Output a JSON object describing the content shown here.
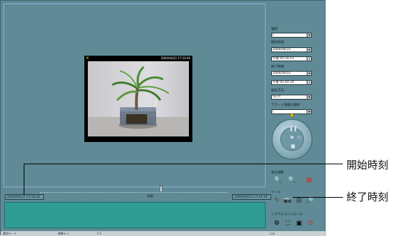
{
  "viewer": {
    "timestamp": "2004/04/22 17:23:40",
    "corner_mark": "✕"
  },
  "timeline": {
    "start": "2004/04/22 17:18:22",
    "end": "2004/04/22 17:43:16",
    "middle": "先頭"
  },
  "sidebar": {
    "field1_label": "場所:",
    "field1_value": "J",
    "start_label": "開始時間:",
    "start_date": "2004/04/22",
    "start_time": "午後 05:10:23",
    "end_label": "終了時間:",
    "end_date": "2004/04/22",
    "end_time": "午後 05:40:19",
    "playmode_label": "再生方法:",
    "playmode_value": "ﾜﾙﾚﾝｸﾞ",
    "alarm_label": "アラート領域の選択:",
    "alarm_value": "J",
    "display_label": "表示調整",
    "tools_label": "ツール",
    "system_label": "システムコントロール"
  },
  "statusbar": {
    "left": "運用モード",
    "mid1": "標準ﾌﾚｰﾄﾞ",
    "mid2": "1:1",
    "right": "ｺﾝ/ﾙ"
  },
  "callouts": {
    "start_time": "開始時刻",
    "end_time": "終了時刻"
  },
  "colors": {
    "window_bg": "#5f8a96",
    "panel_teal": "#2f9d93",
    "viewer_border": "#9aa7d8",
    "led": "#ffd600"
  },
  "icons": {
    "zoom_in": "magnifier-plus-icon",
    "zoom_out": "magnifier-minus-icon",
    "color_adjust": "color-palette-icon",
    "tool_pen": "pencil-icon",
    "tool_camera": "camera-icon",
    "tool_print": "printer-icon",
    "tool_search": "search-icon",
    "sys_settings": "settings-icon",
    "sys_network": "network-icon",
    "sys_monitor": "monitor-icon",
    "sys_power": "power-icon"
  }
}
